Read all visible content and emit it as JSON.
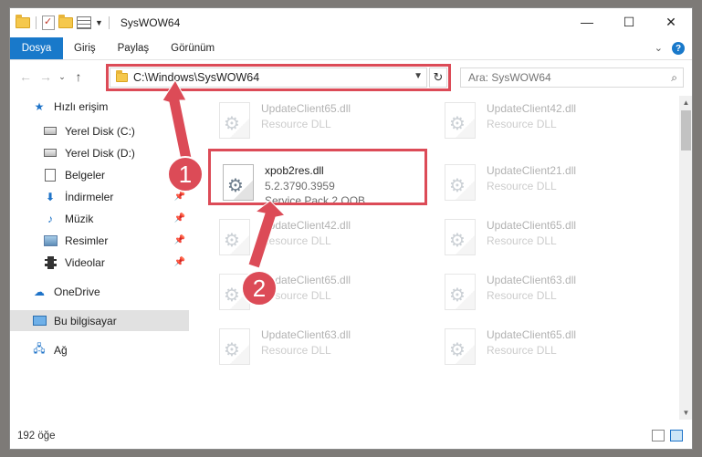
{
  "window": {
    "title": "SysWOW64",
    "controls": [
      "—",
      "☐",
      "✕"
    ]
  },
  "ribbon": {
    "tabs": [
      "Dosya",
      "Giriş",
      "Paylaş",
      "Görünüm"
    ],
    "expand_icon": "chevron-down-icon",
    "help_icon": "?"
  },
  "nav": {
    "address": "C:\\Windows\\SysWOW64",
    "search_placeholder": "Ara: SysWOW64"
  },
  "sidebar": {
    "items": [
      {
        "label": "Hızlı erişim",
        "icon": "star-icon",
        "pinned": false
      },
      {
        "label": "Yerel Disk (C:)",
        "icon": "drive-icon",
        "pinned": false
      },
      {
        "label": "Yerel Disk (D:)",
        "icon": "drive-icon",
        "pinned": false
      },
      {
        "label": "Belgeler",
        "icon": "document-icon",
        "pinned": false
      },
      {
        "label": "İndirmeler",
        "icon": "download-icon",
        "pinned": true
      },
      {
        "label": "Müzik",
        "icon": "music-icon",
        "pinned": true
      },
      {
        "label": "Resimler",
        "icon": "pictures-icon",
        "pinned": true
      },
      {
        "label": "Videolar",
        "icon": "videos-icon",
        "pinned": true
      },
      {
        "label": "OneDrive",
        "icon": "cloud-icon",
        "pinned": false
      },
      {
        "label": "Bu bilgisayar",
        "icon": "computer-icon",
        "pinned": false,
        "selected": true
      },
      {
        "label": "Ağ",
        "icon": "network-icon",
        "pinned": false
      }
    ]
  },
  "files": [
    {
      "name": "UpdateClient65.dll",
      "line2": "Resource DLL",
      "line3": ""
    },
    {
      "name": "UpdateClient42.dll",
      "line2": "Resource DLL",
      "line3": ""
    },
    {
      "name": "xpob2res.dll",
      "line2": "5.2.3790.3959",
      "line3": "Service Pack 2 OOB ...",
      "highlighted": true
    },
    {
      "name": "UpdateClient21.dll",
      "line2": "Resource DLL",
      "line3": ""
    },
    {
      "name": "UpdateClient42.dll",
      "line2": "Resource DLL",
      "line3": ""
    },
    {
      "name": "UpdateClient65.dll",
      "line2": "Resource DLL",
      "line3": ""
    },
    {
      "name": "UpdateClient65.dll",
      "line2": "Resource DLL",
      "line3": ""
    },
    {
      "name": "UpdateClient63.dll",
      "line2": "Resource DLL",
      "line3": ""
    },
    {
      "name": "UpdateClient63.dll",
      "line2": "Resource DLL",
      "line3": ""
    },
    {
      "name": "UpdateClient65.dll",
      "line2": "Resource DLL",
      "line3": ""
    }
  ],
  "status": {
    "item_count": "192 öğe"
  },
  "annotations": {
    "step1": "1",
    "step2": "2",
    "color": "#dc4b57"
  }
}
